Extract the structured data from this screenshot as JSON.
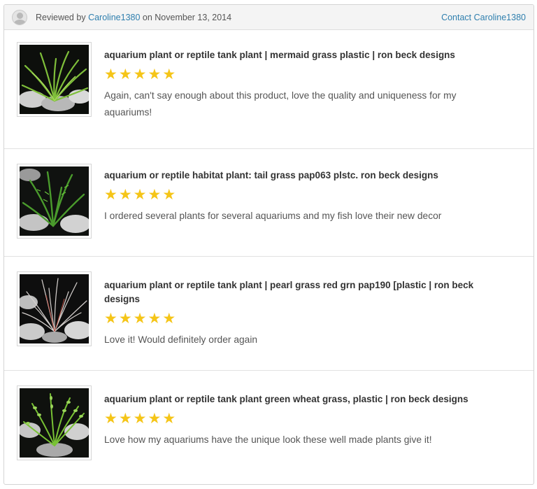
{
  "header": {
    "reviewed_by_prefix": "Reviewed by",
    "reviewer_name": "Caroline1380",
    "date_text": "on November 13, 2014",
    "contact_label": "Contact Caroline1380",
    "avatar_icon": "user-avatar-icon"
  },
  "reviews": [
    {
      "title": "aquarium plant or reptile tank plant | mermaid grass plastic | ron beck designs",
      "rating": 5,
      "text": "Again, can't say enough about this product, love the quality and uniqueness for my aquariums!"
    },
    {
      "title": "aquarium or reptile habitat plant: tail grass pap063 plstc. ron beck designs",
      "rating": 5,
      "text": "I ordered several plants for several aquariums and my fish love their new decor"
    },
    {
      "title": "aquarium plant or reptile tank plant | pearl grass red grn pap190 [plastic | ron beck designs",
      "rating": 5,
      "text": "Love it! Would definitely order again"
    },
    {
      "title": "aquarium plant or reptile tank plant green wheat grass, plastic | ron beck designs",
      "rating": 5,
      "text": "Love how my aquariums have the unique look these well made plants give it!"
    }
  ],
  "colors": {
    "link": "#2f7fae",
    "star": "#f5c518",
    "header_bg": "#f4f4f4"
  }
}
